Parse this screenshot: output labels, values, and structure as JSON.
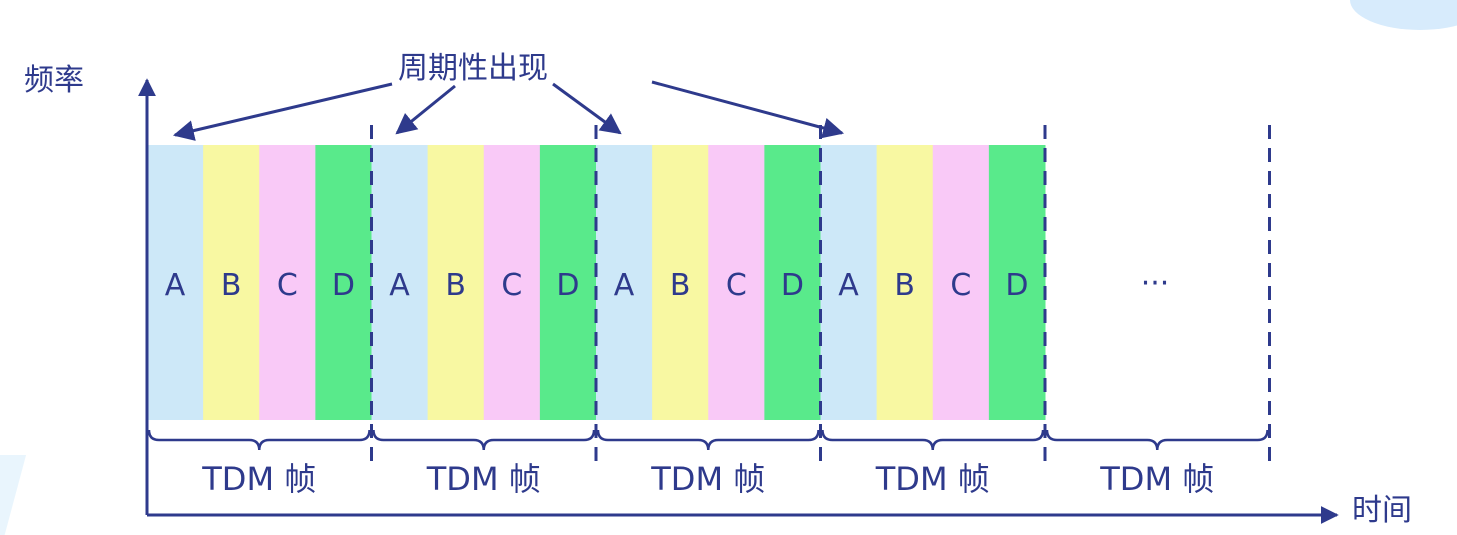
{
  "y_axis_label": "频率",
  "x_axis_label": "时间",
  "annotation": "周期性出现",
  "slots": [
    {
      "label": "A",
      "color": "#cde8f8"
    },
    {
      "label": "B",
      "color": "#f8f8a2"
    },
    {
      "label": "C",
      "color": "#f9c9f7"
    },
    {
      "label": "D",
      "color": "#59ea8b"
    }
  ],
  "frame_count": 5,
  "filled_frames": 4,
  "frame_label": "TDM 帧",
  "ellipsis": "···",
  "colors": {
    "ink": "#2e3a8c",
    "background": "#ffffff"
  }
}
